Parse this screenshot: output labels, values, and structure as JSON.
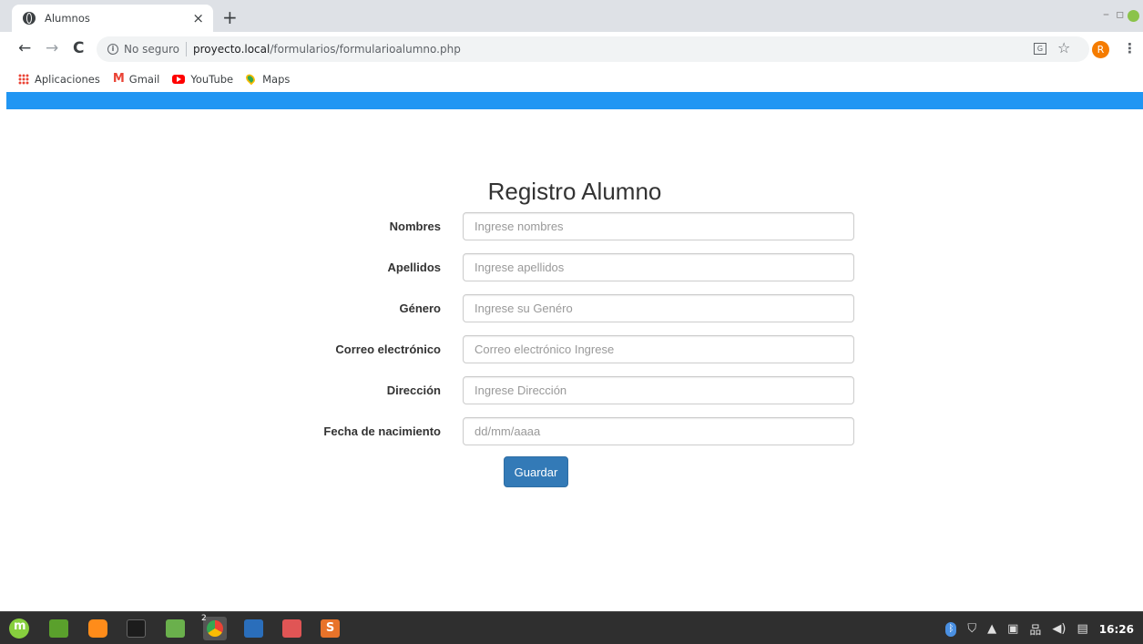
{
  "browser": {
    "tab_title": "Alumnos",
    "tab_close": "×",
    "new_tab": "+",
    "security_label": "No seguro",
    "url_host": "proyecto.local",
    "url_path": "/formularios/formularioalumno.php",
    "avatar_initial": "R",
    "bookmarks": [
      {
        "label": "Aplicaciones"
      },
      {
        "label": "Gmail"
      },
      {
        "label": "YouTube"
      },
      {
        "label": "Maps"
      }
    ]
  },
  "page": {
    "accent_color": "#2196f3",
    "form": {
      "title": "Registro Alumno",
      "fields": [
        {
          "label": "Nombres",
          "placeholder": "Ingrese nombres",
          "value": ""
        },
        {
          "label": "Apellidos",
          "placeholder": "Ingrese apellidos",
          "value": ""
        },
        {
          "label": "Género",
          "placeholder": "Ingrese su Genéro",
          "value": ""
        },
        {
          "label": "Correo electrónico",
          "placeholder": "Correo electrónico Ingrese",
          "value": ""
        },
        {
          "label": "Dirección",
          "placeholder": "Ingrese Dirección",
          "value": ""
        },
        {
          "label": "Fecha de nacimiento",
          "placeholder": "dd/mm/aaaa",
          "value": ""
        }
      ],
      "submit_label": "Guardar",
      "submit_color": "#337ab7"
    }
  },
  "taskbar": {
    "chrome_window_count": "2",
    "sublime_label": "S",
    "clock": "16:26"
  }
}
